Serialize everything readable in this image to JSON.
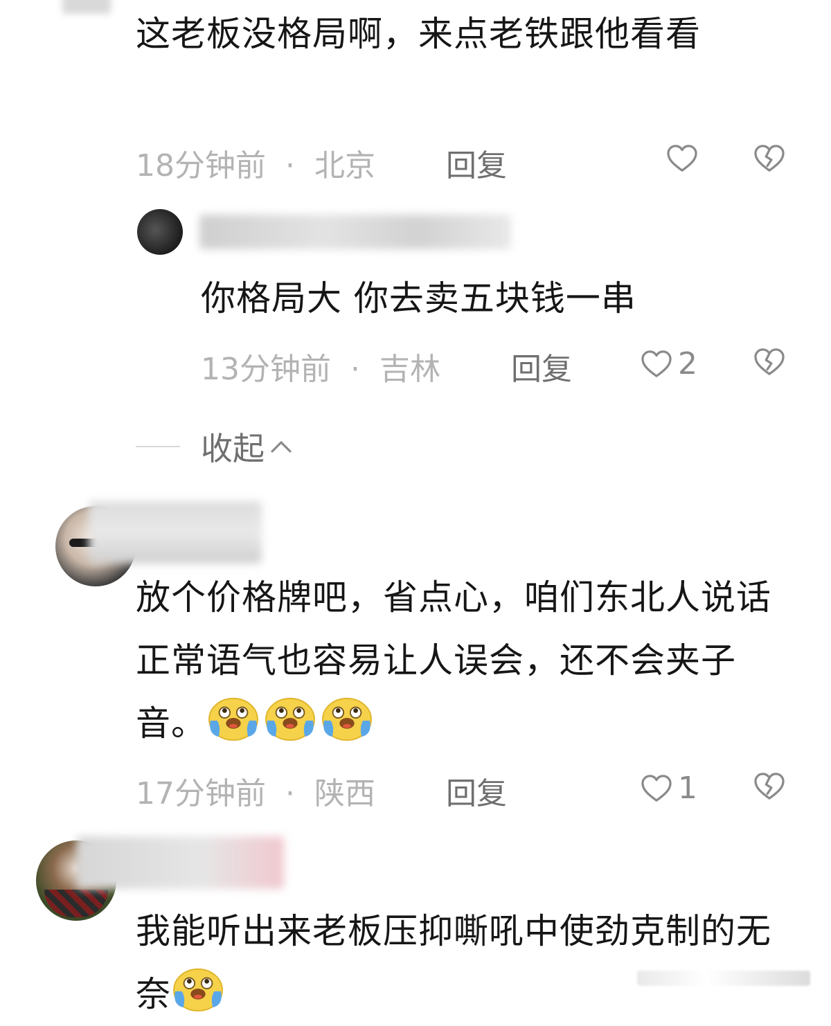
{
  "comments": [
    {
      "text": "这老板没格局啊，来点老铁跟他看看",
      "time": "18分钟前",
      "location": "北京",
      "reply_label": "回复",
      "likes": "",
      "reply": {
        "text": "你格局大 你去卖五块钱一串",
        "time": "13分钟前",
        "location": "吉林",
        "reply_label": "回复",
        "likes": "2"
      },
      "collapse_label": "收起"
    },
    {
      "text": "放个价格牌吧，省点心，咱们东北人说话正常语气也容易让人误会，还不会夹子音。",
      "emoji": [
        "cry-laugh-emoji",
        "cry-laugh-emoji",
        "cry-laugh-emoji"
      ],
      "time": "17分钟前",
      "location": "陕西",
      "reply_label": "回复",
      "likes": "1"
    },
    {
      "text": "我能听出来老板压抑嘶吼中使劲克制的无奈",
      "emoji": [
        "cry-laugh-emoji"
      ]
    }
  ],
  "separator": "·",
  "colors": {
    "text": "#161616",
    "meta": "#b3b3b3",
    "reply_action": "#6f6f6f",
    "icon_stroke": "#8a8a8a",
    "emoji_face": "#f7d64a",
    "emoji_tear": "#5aa7e8"
  }
}
